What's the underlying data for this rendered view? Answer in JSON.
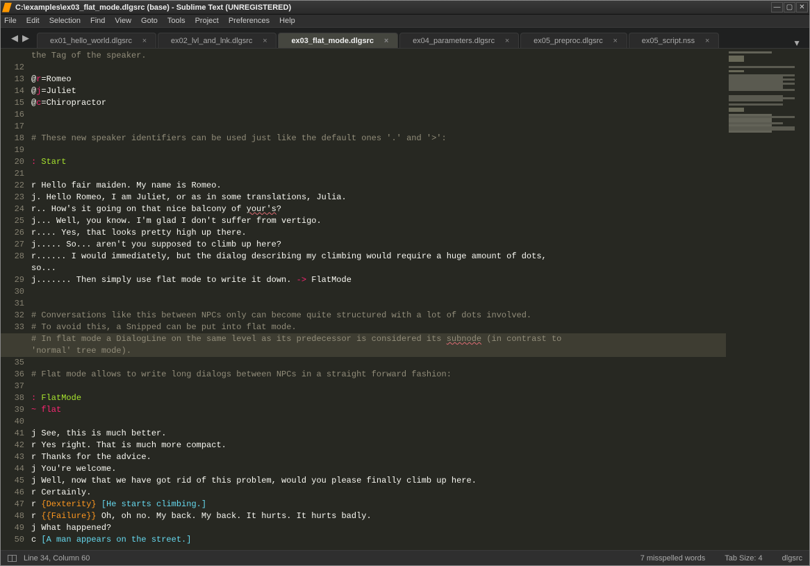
{
  "window": {
    "title": "C:\\examples\\ex03_flat_mode.dlgsrc (base) - Sublime Text (UNREGISTERED)"
  },
  "menu": {
    "items": [
      "File",
      "Edit",
      "Selection",
      "Find",
      "View",
      "Goto",
      "Tools",
      "Project",
      "Preferences",
      "Help"
    ]
  },
  "tabs": {
    "items": [
      {
        "label": "ex01_hello_world.dlgsrc",
        "active": false
      },
      {
        "label": "ex02_lvl_and_lnk.dlgsrc",
        "active": false
      },
      {
        "label": "ex03_flat_mode.dlgsrc",
        "active": true
      },
      {
        "label": "ex04_parameters.dlgsrc",
        "active": false
      },
      {
        "label": "ex05_preproc.dlgsrc",
        "active": false
      },
      {
        "label": "ex05_script.nss",
        "active": false
      }
    ]
  },
  "editor": {
    "first_line": 11,
    "lines": [
      {
        "n": "",
        "segs": [
          {
            "t": "the Tag of the speaker.",
            "c": "grey"
          }
        ]
      },
      {
        "n": 12,
        "segs": []
      },
      {
        "n": 13,
        "segs": [
          {
            "t": "@"
          },
          {
            "t": "r",
            "c": "red"
          },
          {
            "t": "=Romeo"
          }
        ]
      },
      {
        "n": 14,
        "segs": [
          {
            "t": "@"
          },
          {
            "t": "j",
            "c": "red"
          },
          {
            "t": "=Juliet"
          }
        ]
      },
      {
        "n": 15,
        "segs": [
          {
            "t": "@"
          },
          {
            "t": "c",
            "c": "red"
          },
          {
            "t": "=Chiropractor"
          }
        ]
      },
      {
        "n": 16,
        "segs": []
      },
      {
        "n": 17,
        "segs": []
      },
      {
        "n": 18,
        "segs": [
          {
            "t": "# These new speaker identifiers can be used just like the default ones '.' and '>':",
            "c": "grey"
          }
        ]
      },
      {
        "n": 19,
        "segs": []
      },
      {
        "n": 20,
        "segs": [
          {
            "t": ": ",
            "c": "red"
          },
          {
            "t": "Start",
            "c": "green"
          }
        ]
      },
      {
        "n": 21,
        "segs": []
      },
      {
        "n": 22,
        "segs": [
          {
            "t": "r Hello fair maiden. My name is Romeo."
          }
        ]
      },
      {
        "n": 23,
        "segs": [
          {
            "t": "j. Hello Romeo, I am Juliet, or as in some translations, Julia."
          }
        ]
      },
      {
        "n": 24,
        "segs": [
          {
            "t": "r.. How's it going on that nice balcony of "
          },
          {
            "t": "your's",
            "wavy": true
          },
          {
            "t": "?"
          }
        ]
      },
      {
        "n": 25,
        "segs": [
          {
            "t": "j... Well, you know. I'm glad I don't suffer from vertigo."
          }
        ]
      },
      {
        "n": 26,
        "segs": [
          {
            "t": "r.... Yes, that looks pretty high up there."
          }
        ]
      },
      {
        "n": 27,
        "segs": [
          {
            "t": "j..... So... aren't you supposed to climb up here?"
          }
        ]
      },
      {
        "n": 28,
        "segs": [
          {
            "t": "r...... I would immediately, but the dialog describing my climbing would require a huge amount of dots, so..."
          }
        ]
      },
      {
        "n": 29,
        "segs": [
          {
            "t": "j....... Then simply use flat mode to write it down. "
          },
          {
            "t": "->",
            "c": "red"
          },
          {
            "t": " FlatMode"
          }
        ]
      },
      {
        "n": 30,
        "segs": []
      },
      {
        "n": 31,
        "segs": []
      },
      {
        "n": 32,
        "segs": [
          {
            "t": "# Conversations like this between NPCs only can become quite structured with a lot of dots involved.",
            "c": "grey"
          }
        ]
      },
      {
        "n": 33,
        "segs": [
          {
            "t": "# To avoid this, a Snipped can be put into flat mode.",
            "c": "grey"
          }
        ]
      },
      {
        "n": 34,
        "active": true,
        "segs": [
          {
            "t": "# In flat mode a DialogLine on the same level as its predecessor is considered its ",
            "c": "grey"
          },
          {
            "t": "subnode",
            "c": "grey",
            "wavy": true
          },
          {
            "t": " (in contrast to 'normal' tree mode).",
            "c": "grey"
          }
        ]
      },
      {
        "n": 35,
        "segs": []
      },
      {
        "n": 36,
        "segs": [
          {
            "t": "# Flat mode allows to write long dialogs between NPCs in a straight forward fashion:",
            "c": "grey"
          }
        ]
      },
      {
        "n": 37,
        "segs": []
      },
      {
        "n": 38,
        "segs": [
          {
            "t": ": ",
            "c": "red"
          },
          {
            "t": "FlatMode",
            "c": "green"
          }
        ]
      },
      {
        "n": 39,
        "segs": [
          {
            "t": "~ ",
            "c": "red"
          },
          {
            "t": "flat",
            "c": "red"
          }
        ]
      },
      {
        "n": 40,
        "segs": []
      },
      {
        "n": 41,
        "segs": [
          {
            "t": "j See, this is much better."
          }
        ]
      },
      {
        "n": 42,
        "segs": [
          {
            "t": "r Yes right. That is much more compact."
          }
        ]
      },
      {
        "n": 43,
        "segs": [
          {
            "t": "r Thanks for the advice."
          }
        ]
      },
      {
        "n": 44,
        "segs": [
          {
            "t": "j You're welcome."
          }
        ]
      },
      {
        "n": 45,
        "segs": [
          {
            "t": "j Well, now that we have got rid of this problem, would you please finally climb up here."
          }
        ]
      },
      {
        "n": 46,
        "segs": [
          {
            "t": "r Certainly."
          }
        ]
      },
      {
        "n": 47,
        "segs": [
          {
            "t": "r "
          },
          {
            "t": "{Dexterity}",
            "c": "orange"
          },
          {
            "t": " "
          },
          {
            "t": "[He starts climbing.]",
            "c": "cyan"
          }
        ]
      },
      {
        "n": 48,
        "segs": [
          {
            "t": "r "
          },
          {
            "t": "{{Failure}}",
            "c": "orange"
          },
          {
            "t": " Oh, oh no. My back. My back. It hurts. It hurts badly."
          }
        ]
      },
      {
        "n": 49,
        "segs": [
          {
            "t": "j What happened?"
          }
        ]
      },
      {
        "n": 50,
        "segs": [
          {
            "t": "c "
          },
          {
            "t": "[A man appears on the street.]",
            "c": "cyan"
          }
        ]
      }
    ]
  },
  "status": {
    "position": "Line 34, Column 60",
    "spell": "7 misspelled words",
    "tabsize": "Tab Size: 4",
    "syntax": "dlgsrc"
  }
}
